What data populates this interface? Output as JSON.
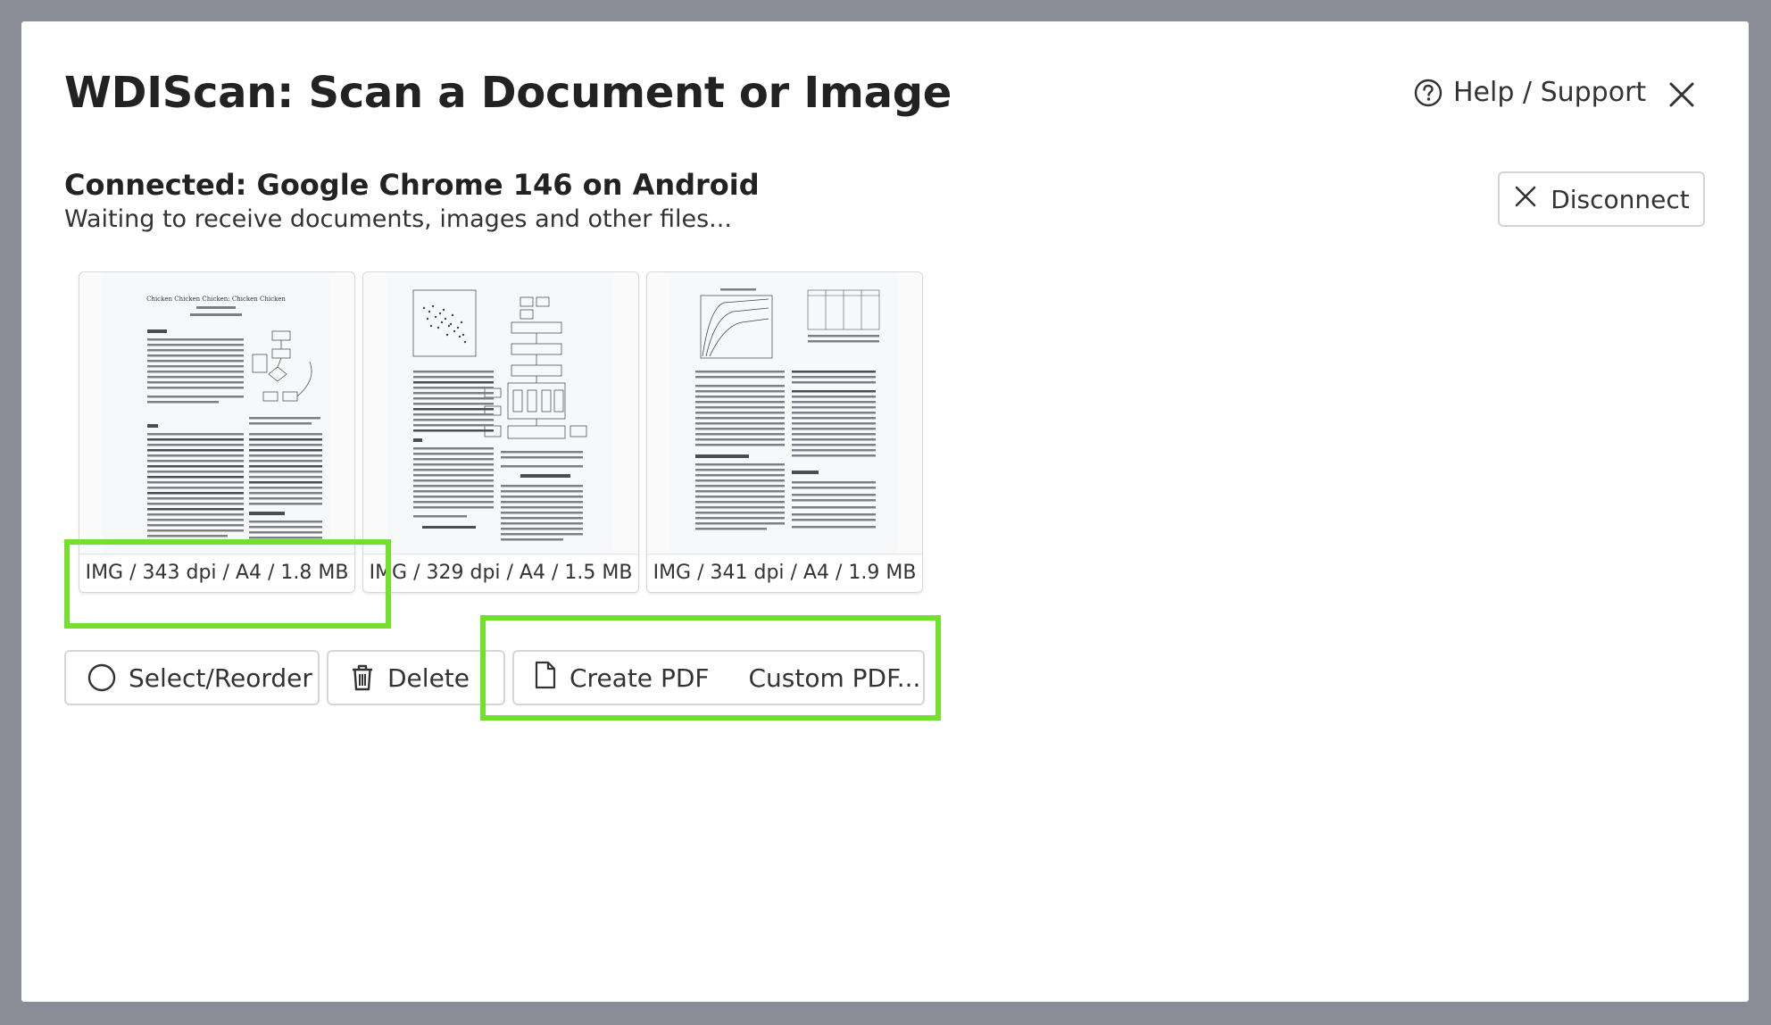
{
  "modal": {
    "title": "WDIScan: Scan a Document or Image",
    "help_label": "Help / Support",
    "help_icon": "question-circle-icon",
    "close_icon": "close-icon"
  },
  "connection": {
    "status": "Connected: Google Chrome 146 on Android",
    "message": "Waiting to receive documents, images and other files...",
    "disconnect_label": "Disconnect"
  },
  "documents": [
    {
      "caption": "IMG / 343 dpi / A4 / 1.8 MB",
      "doc_title": "Chicken Chicken Chicken: Chicken Chicken"
    },
    {
      "caption": "IMG / 329 dpi / A4 / 1.5 MB"
    },
    {
      "caption": "IMG / 341 dpi / A4 / 1.9 MB"
    }
  ],
  "actions": {
    "select_reorder": "Select/Reorder",
    "delete": "Delete",
    "create_pdf": "Create PDF",
    "custom_pdf": "Custom PDF..."
  },
  "colors": {
    "highlight": "#72e02c",
    "backdrop": "#8a8d96"
  }
}
